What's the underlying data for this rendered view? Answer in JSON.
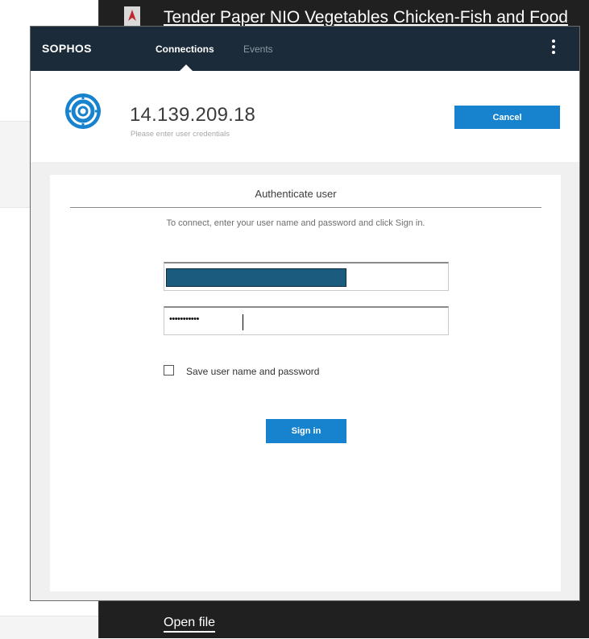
{
  "background": {
    "file_title": "Tender Paper NIO Vegetables Chicken-Fish and Food",
    "open_file_label": "Open file",
    "icons": {
      "file_type": "pdf-icon"
    }
  },
  "dialog": {
    "brand": "SOPHOS",
    "tabs": [
      {
        "label": "Connections",
        "active": true
      },
      {
        "label": "Events",
        "active": false
      }
    ],
    "menu_icon": "kebab-menu-icon",
    "connection": {
      "icon": "target-connection-icon",
      "address": "14.139.209.18",
      "subtitle": "Please enter user credentials",
      "cancel_label": "Cancel"
    },
    "auth": {
      "title": "Authenticate user",
      "instructions": "To connect, enter your user name and password and click Sign in.",
      "password_mask": "•••••••••••",
      "save_checkbox_checked": false,
      "save_label": "Save user name and password",
      "signin_label": "Sign in"
    }
  },
  "colors": {
    "topbar": "#1c2b39",
    "accent_button": "#1782ce",
    "connection_icon": "#1782ce",
    "redacted_username": "#1b5c7e"
  }
}
